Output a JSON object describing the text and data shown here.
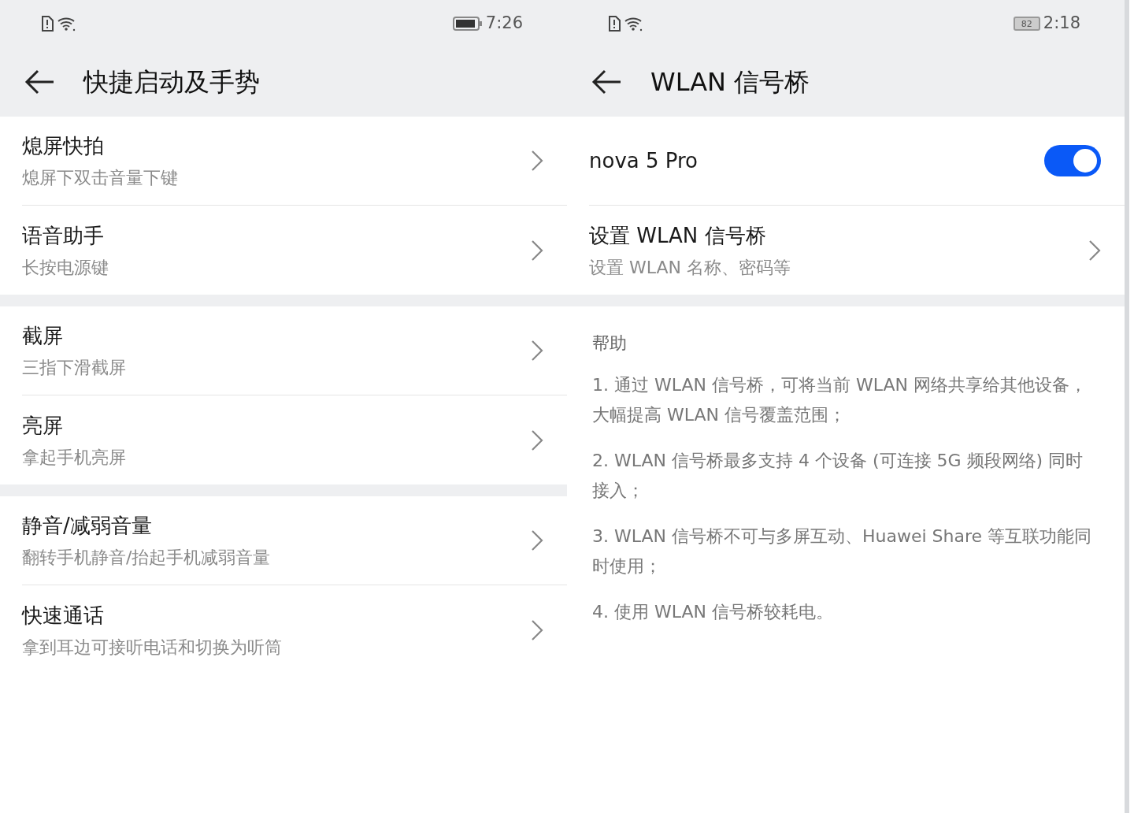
{
  "screens": [
    {
      "status_bar": {
        "time": "7:26"
      },
      "title": "快捷启动及手势",
      "sections": [
        {
          "items": [
            {
              "kind": "link",
              "title": "熄屏快拍",
              "subtitle": "熄屏下双击音量下键"
            },
            {
              "kind": "link",
              "title": "语音助手",
              "subtitle": "长按电源键"
            }
          ]
        },
        {
          "items": [
            {
              "kind": "link",
              "title": "截屏",
              "subtitle": "三指下滑截屏"
            },
            {
              "kind": "link",
              "title": "亮屏",
              "subtitle": "拿起手机亮屏"
            }
          ]
        },
        {
          "items": [
            {
              "kind": "link",
              "title": "静音/减弱音量",
              "subtitle": "翻转手机静音/抬起手机减弱音量"
            },
            {
              "kind": "link",
              "title": "快速通话",
              "subtitle": "拿到耳边可接听电话和切换为听筒"
            }
          ]
        }
      ]
    },
    {
      "status_bar": {
        "time": "2:18",
        "battery_text": "82"
      },
      "title": "WLAN 信号桥",
      "sections": [
        {
          "items": [
            {
              "kind": "switch",
              "title": "nova 5 Pro",
              "on": true
            },
            {
              "kind": "link",
              "title": "设置 WLAN 信号桥",
              "subtitle": "设置 WLAN 名称、密码等"
            }
          ]
        }
      ],
      "help": {
        "heading": "帮助",
        "paragraphs": [
          "1. 通过 WLAN 信号桥，可将当前 WLAN 网络共享给其他设备，大幅提高 WLAN 信号覆盖范围；",
          "2. WLAN 信号桥最多支持 4 个设备 (可连接 5G 频段网络) 同时接入；",
          "3. WLAN 信号桥不可与多屏互动、Huawei Share 等互联功能同时使用；",
          "4. 使用 WLAN 信号桥较耗电。"
        ]
      }
    }
  ]
}
